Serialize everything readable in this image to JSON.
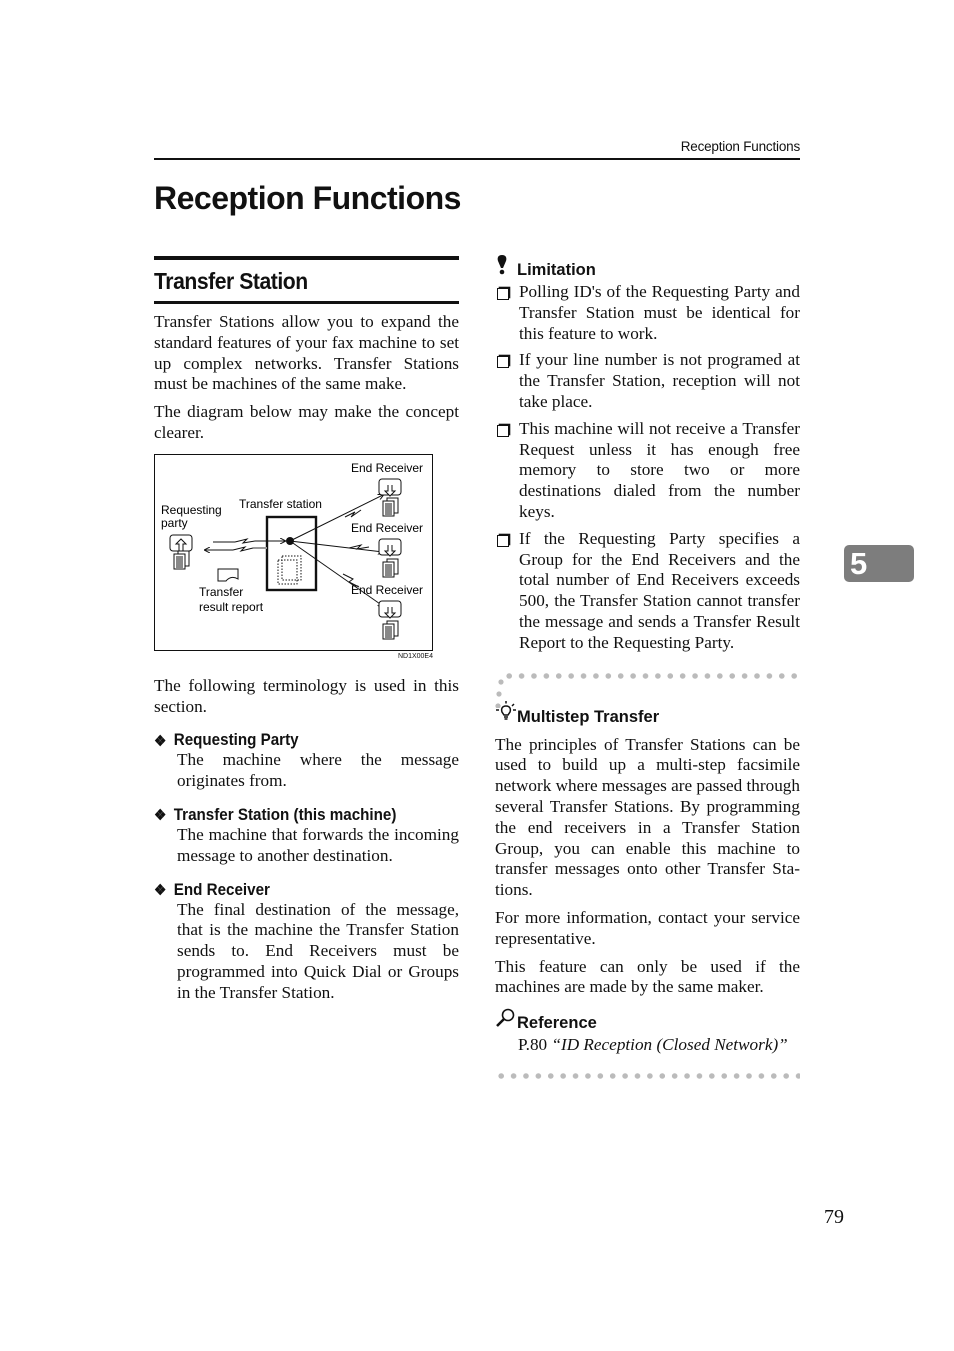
{
  "running_head": "Reception Functions",
  "page_title": "Reception Functions",
  "chapter_tab": "5",
  "page_number": "79",
  "left": {
    "section_title": "Transfer Station",
    "intro_paragraphs": [
      "Transfer Stations allow you to expand the standard features of your fax ma­chine to set up complex networks. Transfer Stations must be machines of the same make.",
      "The diagram below may make the concept clearer."
    ],
    "diagram": {
      "labels": {
        "requesting_party_1": "Requesting",
        "requesting_party_2": "party",
        "transfer_station": "Transfer station",
        "end_receiver_1": "End Receiver",
        "end_receiver_2": "End Receiver",
        "end_receiver_3": "End Receiver",
        "transfer_report_1": "Transfer",
        "transfer_report_2": "result report"
      },
      "code": "ND1X00E4"
    },
    "terminology_intro": "The following terminology is used in this section.",
    "terms": [
      {
        "term": "Requesting Party",
        "definition": "The machine where the message originates from."
      },
      {
        "term": "Transfer Station (this machine)",
        "definition": "The machine that forwards the in­coming message to another desti­nation."
      },
      {
        "term": "End Receiver",
        "definition": "The final destination of the mes­sage, that is the machine the Trans­fer Station sends to. End Receivers must be programmed into Quick Dial or Groups in the Transfer Sta­tion."
      }
    ]
  },
  "right": {
    "limitation": {
      "heading": "Limitation",
      "icon": "exclamation-icon",
      "items": [
        "Polling ID's of the Requesting Par­ty and Transfer Station must be identical for this feature to work.",
        "If your line number is not pro­gramed at the Transfer Station, re­ception will not take place.",
        "This machine will not receive a Transfer Request unless it has enough free memory to store two or more destinations dialed from the number keys.",
        "If the Requesting Party specifies a Group for the End Receivers and the total number of End Receivers exceeds 500, the Transfer Station cannot transfer the message and sends a Transfer Result Report to the Requesting Party."
      ]
    },
    "tip": {
      "heading": "Multistep Transfer",
      "icon": "lightbulb-icon",
      "paragraphs": [
        "The principles of Transfer Stations can be used to build up a multi-step facsimile network where messages are passed through several Transfer Stations. By programming the end re­ceivers in a Transfer Station Group, you can enable this machine to trans­fer messages onto other Transfer Sta­tions.",
        "For more information, contact your service representative.",
        "This feature can only be used if the machines are made by the same mak­er."
      ]
    },
    "reference": {
      "heading": "Reference",
      "icon": "magnifier-icon",
      "page": "P.80",
      "title": "“ID Reception (Closed Net­work)”"
    }
  }
}
